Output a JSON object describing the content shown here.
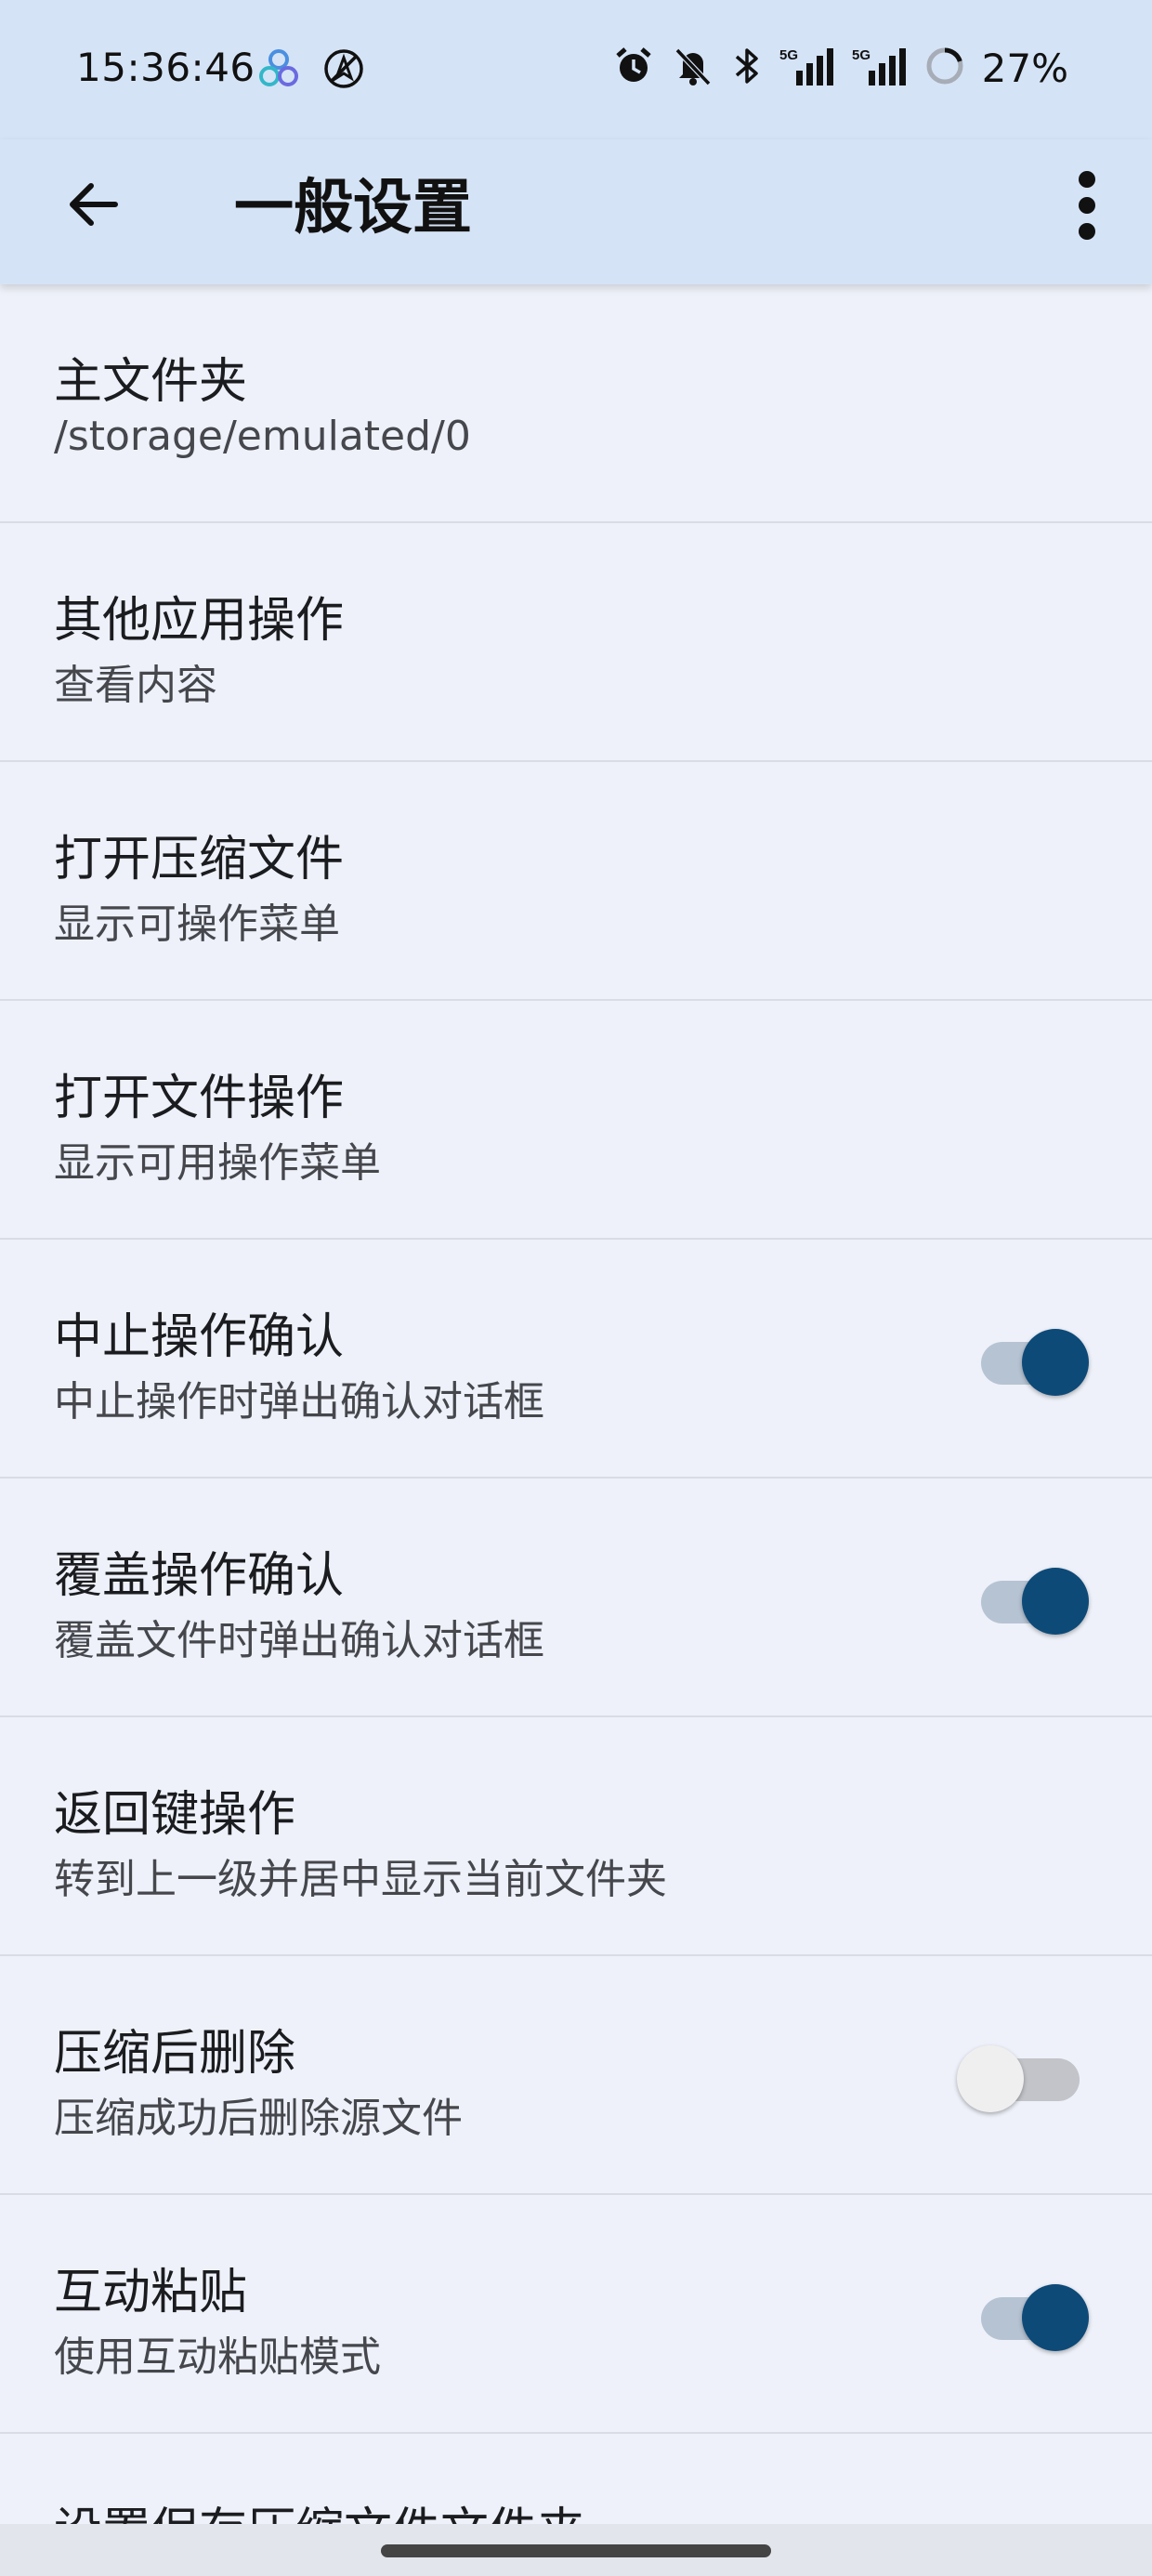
{
  "status_bar": {
    "time": "15:36:46",
    "battery_percent": "27%",
    "battery_level": 27,
    "icons": [
      "app-notification-icon",
      "no-location-icon",
      "alarm-icon",
      "mute-icon",
      "bluetooth-icon",
      "signal-5g-icon",
      "signal-5g-icon",
      "battery-icon"
    ]
  },
  "app_bar": {
    "title": "一般设置",
    "back_icon": "arrow-back-icon",
    "menu_icon": "more-vert-icon",
    "background": "#d5e3f6"
  },
  "settings": [
    {
      "title": "主文件夹",
      "subtitle": "/storage/emulated/0"
    },
    {
      "title": "其他应用操作",
      "subtitle": "查看内容"
    },
    {
      "title": "打开压缩文件",
      "subtitle": "显示可操作菜单"
    },
    {
      "title": "打开文件操作",
      "subtitle": "显示可用操作菜单"
    },
    {
      "title": "中止操作确认",
      "subtitle": "中止操作时弹出确认对话框",
      "toggle": true
    },
    {
      "title": "覆盖操作确认",
      "subtitle": "覆盖文件时弹出确认对话框",
      "toggle": true
    },
    {
      "title": "返回键操作",
      "subtitle": "转到上一级并居中显示当前文件夹"
    },
    {
      "title": "压缩后删除",
      "subtitle": "压缩成功后删除源文件",
      "toggle": false
    },
    {
      "title": "互动粘贴",
      "subtitle": "使用互动粘贴模式",
      "toggle": true
    },
    {
      "title": "设置保存压缩文件文件夹",
      "subtitle": ""
    }
  ],
  "colors": {
    "accent": "#0d4a78",
    "list_background": "#eef1f9"
  }
}
